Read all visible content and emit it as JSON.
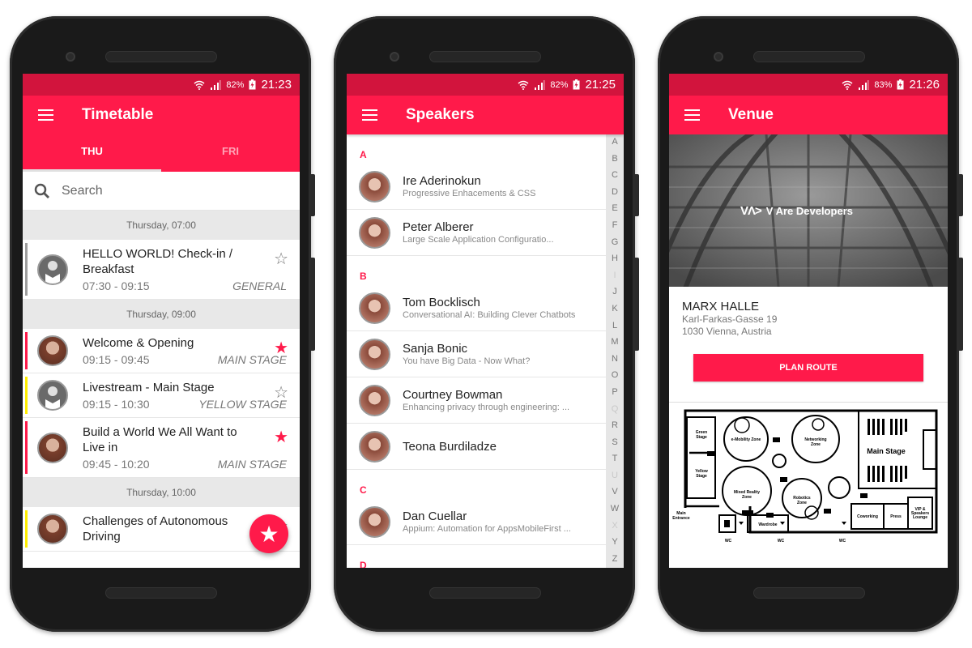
{
  "colors": {
    "primary": "#ff1a4a",
    "status_bar": "#d2143d",
    "track_general": "#9e9e9e",
    "track_main": "#ff1a4a",
    "track_yellow": "#ffee00"
  },
  "phones": [
    {
      "status": {
        "battery": "82%",
        "time": "21:23"
      },
      "title": "Timetable",
      "tabs": [
        {
          "label": "THU",
          "active": true
        },
        {
          "label": "FRI",
          "active": false
        }
      ],
      "search": {
        "placeholder": "Search",
        "value": ""
      },
      "sections": [
        {
          "header": "Thursday, 07:00",
          "sessions": [
            {
              "title": "HELLO WORLD! Check-in / Breakfast",
              "time": "07:30 - 09:15",
              "stage": "GENERAL",
              "favorite": false,
              "track": "general",
              "avatar": "placeholder"
            }
          ]
        },
        {
          "header": "Thursday, 09:00",
          "sessions": [
            {
              "title": "Welcome & Opening",
              "time": "09:15 - 09:45",
              "stage": "MAIN STAGE",
              "favorite": true,
              "track": "main",
              "avatar": "photo"
            },
            {
              "title": "Livestream - Main Stage",
              "time": "09:15 - 10:30",
              "stage": "YELLOW STAGE",
              "favorite": false,
              "track": "yellow",
              "avatar": "placeholder"
            },
            {
              "title": "Build a World We All Want to Live in",
              "time": "09:45 - 10:20",
              "stage": "MAIN STAGE",
              "favorite": true,
              "track": "main",
              "avatar": "photo"
            }
          ]
        },
        {
          "header": "Thursday, 10:00",
          "sessions": [
            {
              "title": "Challenges of Autonomous Driving",
              "time": "",
              "stage": "",
              "favorite": false,
              "track": "yellow",
              "avatar": "photo"
            }
          ]
        }
      ],
      "fab_icon": "star-icon"
    },
    {
      "status": {
        "battery": "82%",
        "time": "21:25"
      },
      "title": "Speakers",
      "groups": [
        {
          "letter": "A",
          "speakers": [
            {
              "name": "Ire Aderinokun",
              "talk": "Progressive Enhacements & CSS"
            },
            {
              "name": "Peter Alberer",
              "talk": "Large Scale Application Configuratio..."
            }
          ]
        },
        {
          "letter": "B",
          "speakers": [
            {
              "name": "Tom Bocklisch",
              "talk": "Conversational AI: Building Clever Chatbots"
            },
            {
              "name": "Sanja Bonic",
              "talk": "You have Big Data - Now What?"
            },
            {
              "name": "Courtney Bowman",
              "talk": "Enhancing privacy through engineering: ..."
            },
            {
              "name": "Teona Burdiladze",
              "talk": ""
            }
          ]
        },
        {
          "letter": "C",
          "speakers": [
            {
              "name": "Dan Cuellar",
              "talk": "Appium: Automation for AppsMobileFirst ..."
            }
          ]
        },
        {
          "letter": "D",
          "speakers": []
        }
      ],
      "index": [
        "A",
        "B",
        "C",
        "D",
        "E",
        "F",
        "G",
        "H",
        "I",
        "J",
        "K",
        "L",
        "M",
        "N",
        "O",
        "P",
        "Q",
        "R",
        "S",
        "T",
        "U",
        "V",
        "W",
        "X",
        "Y",
        "Z"
      ],
      "index_disabled": [
        "I",
        "Q",
        "U",
        "X"
      ]
    },
    {
      "status": {
        "battery": "83%",
        "time": "21:26"
      },
      "title": "Venue",
      "hero_logo": {
        "mark": "VΛ>",
        "text": "V Are Developers"
      },
      "venue": {
        "name": "MARX HALLE",
        "street": "Karl-Farkas-Gasse 19",
        "city": "1030 Vienna, Austria"
      },
      "plan_route": "PLAN ROUTE",
      "map": {
        "labels": [
          "Green Stage",
          "Yellow Stage",
          "e-Mobility Zone",
          "Networking Zone",
          "Main Stage",
          "Mixed Reality Zone",
          "Robotics Zone",
          "Main Entrance",
          "Wardrobe",
          "Coworking",
          "Press",
          "VIP & Speakers Lounge",
          "WC",
          "WC",
          "WC"
        ]
      }
    }
  ]
}
